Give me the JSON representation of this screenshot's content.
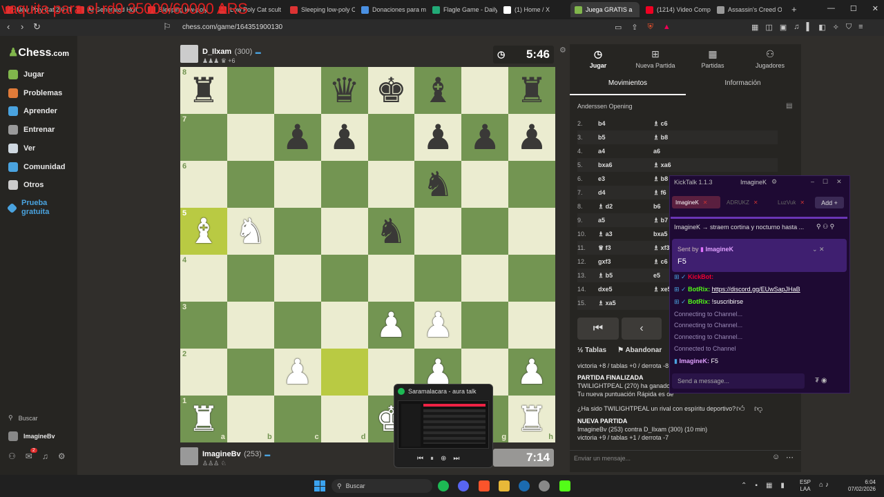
{
  "overlay_text": "vaquita para el rd9 35000/60000 ARS",
  "browser": {
    "tabs": [
      "New Poly Cat 2.0 (T",
      "AI Generated Holl",
      "Sleeping low-poly",
      "Low Poly Cat scult",
      "Sleeping low-poly C",
      "Donaciones para m",
      "Flagle Game - Daily",
      "(1) Home / X",
      "Juega GRATIS a",
      "(1214) Video Comp",
      "Assassin's Creed Or"
    ],
    "active_tab_index": 8,
    "url": "chess.com/game/164351900130",
    "new_tab": "+"
  },
  "sidebar": {
    "logo_main": "Chess",
    "logo_suffix": ".com",
    "items": [
      {
        "label": "Jugar",
        "color": "#81b64c"
      },
      {
        "label": "Problemas",
        "color": "#e07b39"
      },
      {
        "label": "Aprender",
        "color": "#4aa3df"
      },
      {
        "label": "Entrenar",
        "color": "#9a9a9a"
      },
      {
        "label": "Ver",
        "color": "#cfd8e0"
      },
      {
        "label": "Comunidad",
        "color": "#4aa3df"
      },
      {
        "label": "Otros",
        "color": "#cccccc"
      }
    ],
    "premium_label": "Prueba gratuita",
    "search_label": "Buscar",
    "user_label": "ImagineBv",
    "notif_count": "2"
  },
  "top_player": {
    "name": "D_Ilxam",
    "rating": "(300)",
    "extra": "+6",
    "clock": "5:46"
  },
  "bottom_player": {
    "name": "ImagineBv",
    "rating": "(253)",
    "clock": "7:14"
  },
  "board": {
    "ranks": [
      "8",
      "7",
      "6",
      "5",
      "4",
      "3",
      "2",
      "1"
    ],
    "files": [
      "a",
      "b",
      "c",
      "d",
      "e",
      "f",
      "g",
      "h"
    ],
    "rows": [
      [
        "br",
        "",
        "",
        "bq",
        "bk",
        "bb",
        "",
        "br"
      ],
      [
        "",
        "",
        "bp",
        "bp",
        "",
        "bp",
        "bp",
        "bp"
      ],
      [
        "",
        "",
        "",
        "",
        "",
        "bn",
        "",
        ""
      ],
      [
        "wb",
        "wn",
        "",
        "",
        "bn",
        "",
        "",
        ""
      ],
      [
        "",
        "",
        "",
        "",
        "",
        "",
        "",
        ""
      ],
      [
        "",
        "",
        "",
        "",
        "wp",
        "wp",
        "",
        ""
      ],
      [
        "",
        "",
        "wp",
        "",
        "",
        "wp",
        "",
        "wp"
      ],
      [
        "wr",
        "",
        "",
        "",
        "wk",
        "",
        "",
        "wr"
      ]
    ]
  },
  "right_panel": {
    "tabs": [
      "Jugar",
      "Nueva Partida",
      "Partidas",
      "Jugadores"
    ],
    "subtabs": [
      "Movimientos",
      "Información"
    ],
    "opening": "Anderssen Opening",
    "moves": [
      {
        "n": "2.",
        "w": "b4",
        "b": "♗ c6"
      },
      {
        "n": "3.",
        "w": "b5",
        "b": "♗ b8"
      },
      {
        "n": "4.",
        "w": "a4",
        "b": "a6"
      },
      {
        "n": "5.",
        "w": "bxa6",
        "b": "♗ xa6"
      },
      {
        "n": "6.",
        "w": "e3",
        "b": "♗ b8"
      },
      {
        "n": "7.",
        "w": "d4",
        "b": "♗ f6"
      },
      {
        "n": "8.",
        "w": "♗ d2",
        "b": "b6"
      },
      {
        "n": "9.",
        "w": "a5",
        "b": "♗ b7"
      },
      {
        "n": "10.",
        "w": "♗ a3",
        "b": "bxa5"
      },
      {
        "n": "11.",
        "w": "♕ f3",
        "b": "♗ xf3"
      },
      {
        "n": "12.",
        "w": "gxf3",
        "b": "♗ c6"
      },
      {
        "n": "13.",
        "w": "♗ b5",
        "b": "e5"
      },
      {
        "n": "14.",
        "w": "dxe5",
        "b": "♗ xe5"
      },
      {
        "n": "15.",
        "w": "♗ xa5",
        "b": ""
      }
    ],
    "draw_label": "Tablas",
    "resign_label": "Abandonar",
    "chat": [
      "victoria +8 / tablas +0 / derrota -8",
      "PARTIDA FINALIZADA",
      "TWILIGHTPEAL (270) ha ganado p",
      "Tu nueva puntuación Rápida es de",
      "¿Ha sido TWILIGHTPEAL un rival con espíritu deportivo?",
      "NUEVA PARTIDA",
      "ImagineBv (253) contra D_Ilxam (300) (10 min)",
      "victoria +9 / tablas +1 / derrota -7"
    ],
    "chat_placeholder": "Enviar un mensaje..."
  },
  "kicktalk": {
    "title": "KickTalk 1.1.3",
    "user": "ImagineK",
    "tabs": [
      "ImagineK",
      "ADRUKZ",
      "LuzVuk"
    ],
    "add_label": "Add",
    "pinned": "ImagineK → straem cortina y nocturno hasta ...",
    "sent_by_label": "Sent by",
    "sent_by_user": "ImagineK",
    "sent_msg": "F5",
    "lines": [
      {
        "user": "KickBot:",
        "text": ""
      },
      {
        "user": "BotRix:",
        "text": "https://discord.gg/EUwSapJHaB"
      },
      {
        "user": "BotRix:",
        "text": "!suscribirse"
      },
      {
        "user": "",
        "text": "Connecting to Channel..."
      },
      {
        "user": "",
        "text": "Connecting to Channel..."
      },
      {
        "user": "",
        "text": "Connecting to Channel..."
      },
      {
        "user": "",
        "text": "Connected to Channel"
      },
      {
        "user": "ImagineK:",
        "text": "F5"
      }
    ],
    "input_placeholder": "Send a message..."
  },
  "mini_player": {
    "title": "Saramalacara - aura talk"
  },
  "taskbar": {
    "search_label": "Buscar",
    "lang": "ESP",
    "lang2": "LAA",
    "time": "6:04",
    "date": "07/02/2026"
  }
}
